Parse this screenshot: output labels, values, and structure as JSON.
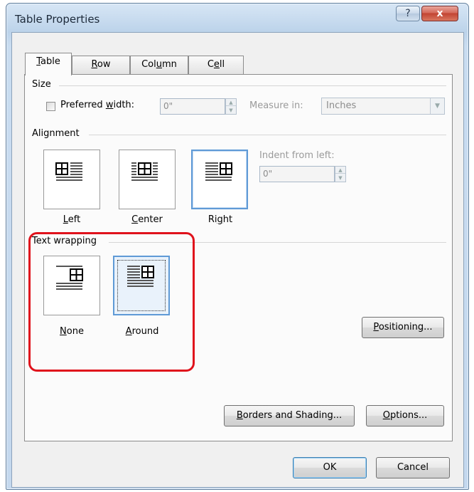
{
  "window": {
    "title": "Table Properties",
    "help_icon": "?",
    "close_icon": "x"
  },
  "tabs": [
    {
      "label_pre": "",
      "label_u": "T",
      "label_post": "able"
    },
    {
      "label_pre": "",
      "label_u": "R",
      "label_post": "ow"
    },
    {
      "label_pre": "Col",
      "label_u": "u",
      "label_post": "mn"
    },
    {
      "label_pre": "C",
      "label_u": "e",
      "label_post": "ll"
    }
  ],
  "size": {
    "group_label": "Size",
    "preferred_width_pre": "Preferred ",
    "preferred_width_u": "w",
    "preferred_width_post": "idth:",
    "width_value": "0\"",
    "measure_in_label": "Measure in:",
    "measure_in_value": "Inches"
  },
  "alignment": {
    "group_label": "Alignment",
    "options": [
      {
        "label_pre": "",
        "label_u": "L",
        "label_post": "eft"
      },
      {
        "label_pre": "",
        "label_u": "C",
        "label_post": "enter"
      },
      {
        "label_pre": "Ri",
        "label_u": "g",
        "label_post": "ht"
      }
    ],
    "indent_label": "Indent from left:",
    "indent_value": "0\""
  },
  "wrapping": {
    "group_label": "Text wrapping",
    "options": [
      {
        "label_pre": "",
        "label_u": "N",
        "label_post": "one"
      },
      {
        "label_pre": "",
        "label_u": "A",
        "label_post": "round"
      }
    ]
  },
  "buttons": {
    "positioning_u": "P",
    "positioning_post": "ositioning...",
    "borders_u": "B",
    "borders_post": "orders and Shading...",
    "options_u": "O",
    "options_post": "ptions...",
    "ok": "OK",
    "cancel": "Cancel"
  },
  "colors": {
    "highlight": "#e0121c",
    "selection": "#5f9ad6"
  },
  "icons": [
    "help-icon",
    "close-icon",
    "align-left-icon",
    "align-center-icon",
    "align-right-icon",
    "wrap-none-icon",
    "wrap-around-icon",
    "spinner-up-icon",
    "spinner-down-icon",
    "dropdown-arrow-icon"
  ]
}
